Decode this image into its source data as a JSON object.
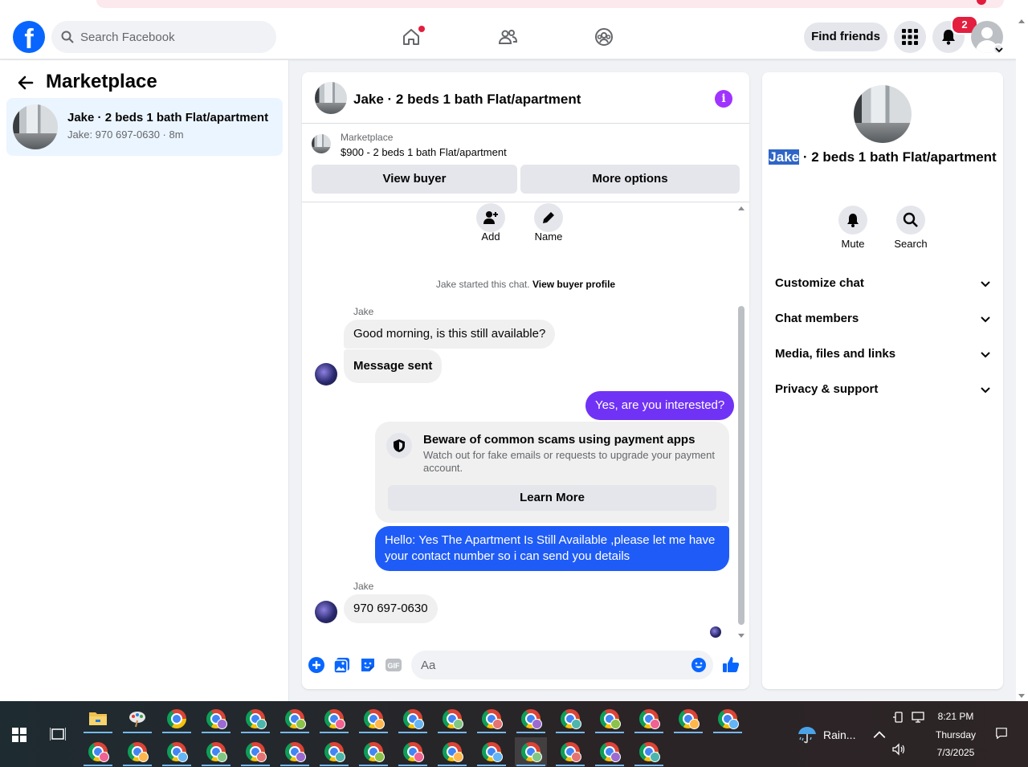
{
  "topbar": {
    "logo": "f",
    "search_placeholder": "Search Facebook",
    "find_friends": "Find friends",
    "notification_count": "2"
  },
  "left": {
    "title": "Marketplace",
    "conversation": {
      "title": "Jake · 2 beds 1 bath Flat/apartment",
      "subtitle": "Jake: 970 697-0630 · 8m"
    }
  },
  "chat": {
    "title": "Jake · 2 beds 1 bath Flat/apartment",
    "info": "i",
    "marketplace_label": "Marketplace",
    "listing": "$900 - 2 beds 1 bath Flat/apartment",
    "view_buyer": "View buyer",
    "more_options": "More options",
    "actions": [
      {
        "label": "Add"
      },
      {
        "label": "Name"
      }
    ],
    "started_text": "Jake started this chat.",
    "view_buyer_profile": "View buyer profile",
    "sender": "Jake",
    "msg1": "Good morning, is this still available?",
    "msg2": "Message sent",
    "msg3": "Yes, are you interested?",
    "scam_title": "Beware of common scams using payment apps",
    "scam_body": "Watch out for fake emails or requests to upgrade your payment account.",
    "learn_more": "Learn More",
    "msg4": "Hello: Yes The Apartment Is Still Available ,please let me have your contact number so i can send you details",
    "msg5": "970 697-0630",
    "composer_placeholder": "Aa"
  },
  "right": {
    "title_highlight": "Jake",
    "title_rest": " · 2 beds 1 bath Flat/apartment",
    "mute": "Mute",
    "search": "Search",
    "sections": [
      "Customize chat",
      "Chat members",
      "Media, files and links",
      "Privacy & support"
    ]
  },
  "taskbar": {
    "weather": "Rain...",
    "time": "8:21 PM",
    "day": "Thursday",
    "date": "7/3/2025"
  },
  "colors": {
    "fb_blue": "#0866ff",
    "messenger_purple": "#7b2ff2",
    "outgoing_blue": "#1f5cf7",
    "badge_red": "#e41e3f"
  }
}
